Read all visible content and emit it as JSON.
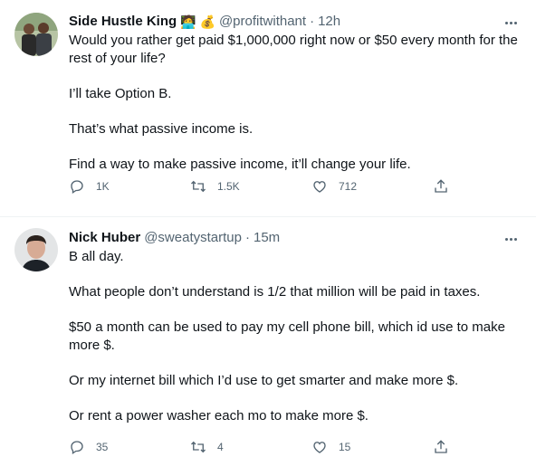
{
  "tweets": [
    {
      "display_name": "Side Hustle King",
      "name_emojis": "🧑‍💻 💰",
      "handle": "@profitwithant",
      "separator": "·",
      "time": "12h",
      "paragraphs": [
        "Would you rather get paid $1,000,000 right now or $50 every month for the rest of your life?",
        "I’ll take Option B.",
        "That’s what passive income is.",
        "Find a way to make passive income, it’ll change your life."
      ],
      "replies": "1K",
      "retweets": "1.5K",
      "likes": "712"
    },
    {
      "display_name": "Nick Huber",
      "handle": "@sweatystartup",
      "separator": "·",
      "time": "15m",
      "paragraphs": [
        "B all day.",
        "What people don’t understand is 1/2 that million will be paid in taxes.",
        "$50 a month can be used to pay my cell phone bill, which id use to make more $.",
        "Or my internet bill which I’d use to get smarter and make more $.",
        "Or rent a power washer each mo to make more $."
      ],
      "replies": "35",
      "retweets": "4",
      "likes": "15"
    }
  ],
  "icons": {
    "reply": "reply-icon",
    "retweet": "retweet-icon",
    "like": "heart-icon",
    "share": "share-icon",
    "more": "more-icon"
  },
  "colors": {
    "text": "#0f1419",
    "secondary": "#536471",
    "divider": "#eff3f4"
  }
}
